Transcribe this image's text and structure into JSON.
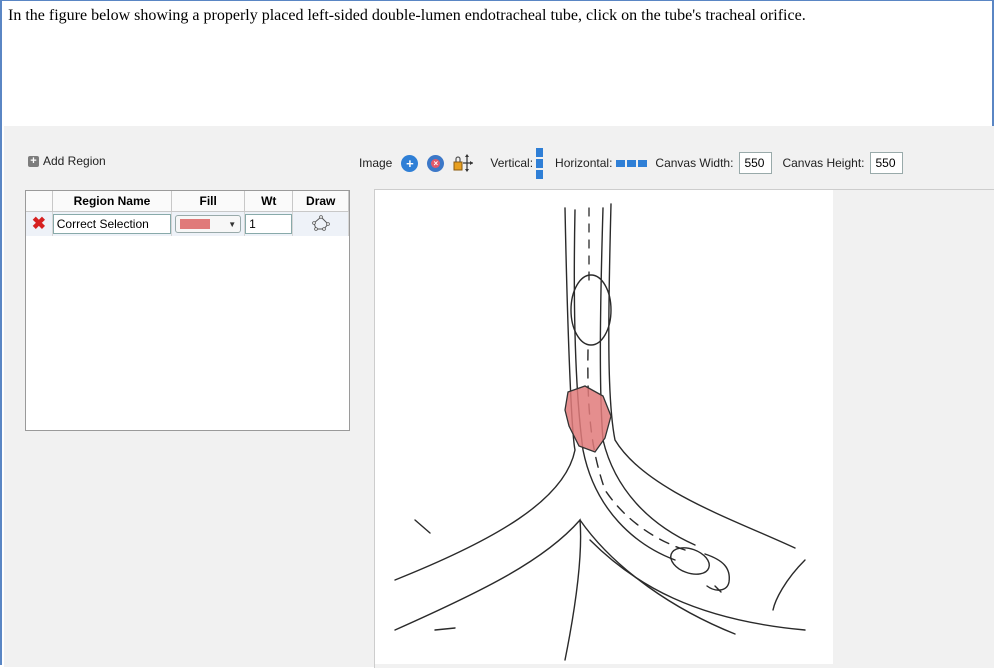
{
  "question": {
    "text": "In the figure below showing a properly placed left-sided double-lumen endotracheal tube, click on the tube's tracheal orifice."
  },
  "region_panel": {
    "add_region_label": "Add Region",
    "columns": [
      "Region Name",
      "Fill",
      "Wt",
      "Draw"
    ],
    "rows": [
      {
        "name": "Correct Selection",
        "fill_color": "#e07a7a",
        "weight": "1",
        "draw_icon": "polygon-draw-icon"
      }
    ]
  },
  "toolbar": {
    "image_label": "Image",
    "vertical_label": "Vertical:",
    "horizontal_label": "Horizontal:",
    "canvas_width_label": "Canvas Width:",
    "canvas_width_value": "550",
    "canvas_height_label": "Canvas Height:",
    "canvas_height_value": "550"
  },
  "colors": {
    "accent": "#2f7fd6",
    "region_fill": "#e07a7a",
    "delete_icon": "#d62020"
  }
}
